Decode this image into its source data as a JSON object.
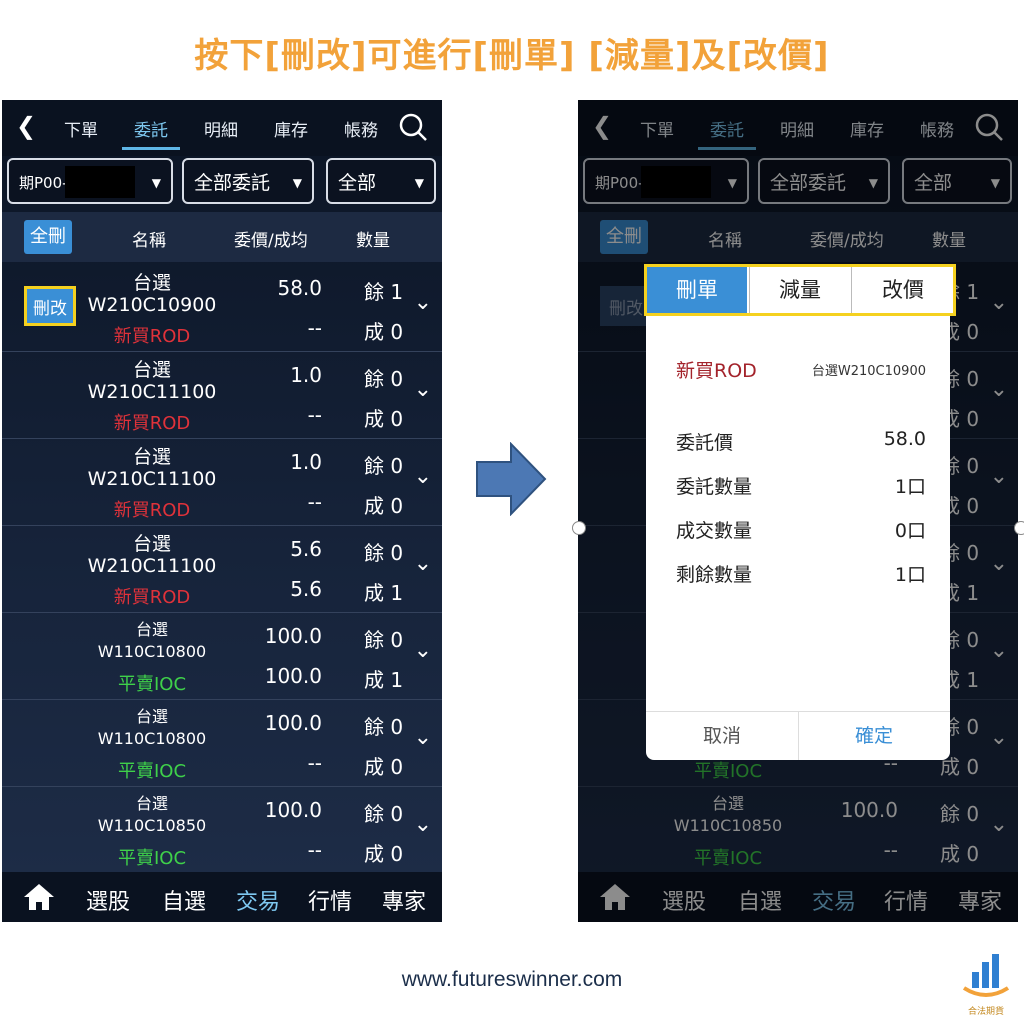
{
  "headline": "按下[刪改]可進行[刪單] [減量]及[改價]",
  "nav": {
    "back_icon": "chevron-left-icon",
    "tabs": [
      "下單",
      "委託",
      "明細",
      "庫存",
      "帳務"
    ],
    "active_tab": "委託"
  },
  "filters": {
    "account": "期P00-",
    "order_kind": "全部委託",
    "side": "全部"
  },
  "table_header": {
    "delete_all": "全刪",
    "name": "名稱",
    "price_avg": "委價/成均",
    "qty": "數量"
  },
  "edit_label": "刪改",
  "orders": [
    {
      "name1": "台選",
      "name2": "W210C10900",
      "type": "新買ROD",
      "price": "58.0",
      "avg": "--",
      "remaining": "餘 1",
      "filled": "成 0"
    },
    {
      "name1": "台選",
      "name2": "W210C11100",
      "type": "新買ROD",
      "price": "1.0",
      "avg": "--",
      "remaining": "餘 0",
      "filled": "成 0"
    },
    {
      "name1": "台選",
      "name2": "W210C11100",
      "type": "新買ROD",
      "price": "1.0",
      "avg": "--",
      "remaining": "餘 0",
      "filled": "成 0"
    },
    {
      "name1": "台選",
      "name2": "W210C11100",
      "type": "新買ROD",
      "price": "5.6",
      "avg": "5.6",
      "remaining": "餘 0",
      "filled": "成 1"
    },
    {
      "name1": "台選",
      "name2": "W110C10800",
      "type": "平賣IOC",
      "price": "100.0",
      "avg": "100.0",
      "remaining": "餘 0",
      "filled": "成 1"
    },
    {
      "name1": "台選",
      "name2": "W110C10800",
      "type": "平賣IOC",
      "price": "100.0",
      "avg": "--",
      "remaining": "餘 0",
      "filled": "成 0"
    },
    {
      "name1": "台選",
      "name2": "W110C10850",
      "type": "平賣IOC",
      "price": "100.0",
      "avg": "--",
      "remaining": "餘 0",
      "filled": "成 0"
    }
  ],
  "bottom_nav": [
    "選股",
    "自選",
    "交易",
    "行情",
    "專家"
  ],
  "bottom_active": "交易",
  "modal": {
    "tabs": [
      "刪單",
      "減量",
      "改價"
    ],
    "order_type": "新買ROD",
    "contract": "台選W210C10900",
    "fields": [
      {
        "label": "委託價",
        "value": "58.0"
      },
      {
        "label": "委託數量",
        "value": "1口"
      },
      {
        "label": "成交數量",
        "value": "0口"
      },
      {
        "label": "剩餘數量",
        "value": "1口"
      }
    ],
    "cancel": "取消",
    "confirm": "確定"
  },
  "footer_url": "www.futureswinner.com",
  "logo_text": "合法期貨",
  "colors": {
    "headline": "#f2a23a",
    "accent_blue": "#3a8fd6",
    "highlight": "#f5d11f",
    "rod": "#e0323a",
    "ioc": "#3fd14a"
  }
}
